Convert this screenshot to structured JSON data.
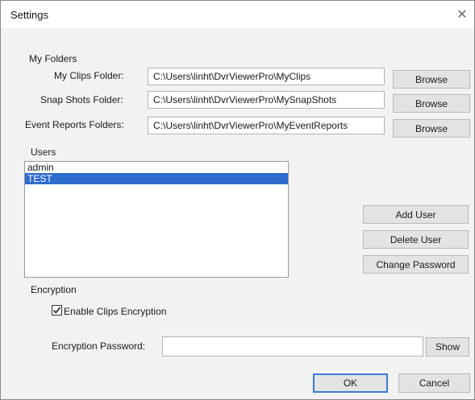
{
  "window": {
    "title": "Settings",
    "close_glyph": "✕"
  },
  "folders": {
    "group_label": "My Folders",
    "clips_label": "My Clips Folder:",
    "clips_path": "C:\\Users\\linht\\DvrViewerPro\\MyClips",
    "snapshots_label": "Snap Shots Folder:",
    "snapshots_path": "C:\\Users\\linht\\DvrViewerPro\\MySnapShots",
    "events_label": "Event Reports Folders:",
    "events_path": "C:\\Users\\linht\\DvrViewerPro\\MyEventReports",
    "browse_label": "Browse"
  },
  "users": {
    "group_label": "Users",
    "items": [
      {
        "name": "admin",
        "selected": false
      },
      {
        "name": "TEST",
        "selected": true
      }
    ],
    "add_label": "Add User",
    "delete_label": "Delete User",
    "change_password_label": "Change Password"
  },
  "encryption": {
    "group_label": "Encryption",
    "enable_label": "Enable Clips Encryption",
    "enabled": true,
    "password_label": "Encryption Password:",
    "password_value": "",
    "show_label": "Show"
  },
  "footer": {
    "ok_label": "OK",
    "cancel_label": "Cancel"
  },
  "colors": {
    "selection": "#2f6ccd",
    "default_button_border": "#3b7ad6"
  }
}
